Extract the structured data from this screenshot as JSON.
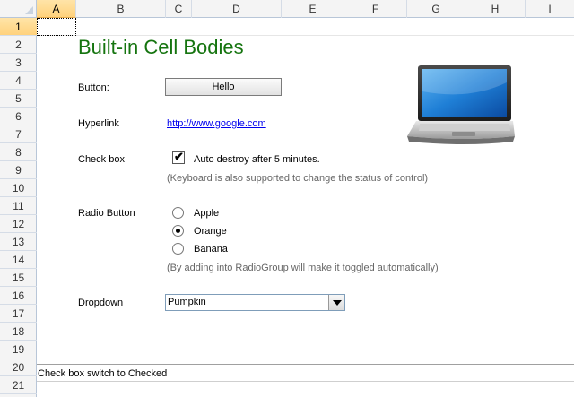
{
  "columns": [
    "A",
    "B",
    "C",
    "D",
    "E",
    "F",
    "G",
    "H",
    "I"
  ],
  "rows": [
    "1",
    "2",
    "3",
    "4",
    "5",
    "6",
    "7",
    "8",
    "9",
    "10",
    "11",
    "12",
    "13",
    "14",
    "15",
    "16",
    "17",
    "18",
    "19",
    "20",
    "21"
  ],
  "title": "Built-in Cell Bodies",
  "labels": {
    "button": "Button:",
    "hyperlink": "Hyperlink",
    "checkbox": "Check box",
    "radio": "Radio Button",
    "dropdown": "Dropdown"
  },
  "button": {
    "label": "Hello"
  },
  "hyperlink": {
    "text": "http://www.google.com"
  },
  "checkbox": {
    "label": "Auto destroy after 5 minutes.",
    "checked": true,
    "mark": "✔",
    "hint": "(Keyboard is also supported to change the status of control)"
  },
  "radio": {
    "options": [
      {
        "label": "Apple",
        "selected": false
      },
      {
        "label": "Orange",
        "selected": true
      },
      {
        "label": "Banana",
        "selected": false
      }
    ],
    "hint": "(By adding into RadioGroup will make it toggled automatically)"
  },
  "dropdown": {
    "value": "Pumpkin"
  },
  "status": {
    "text": "Check box switch to Checked"
  },
  "image": {
    "icon": "laptop-icon"
  },
  "colors": {
    "title": "#15740f",
    "link": "#0000ee",
    "header_selected": "#ffd27c"
  }
}
